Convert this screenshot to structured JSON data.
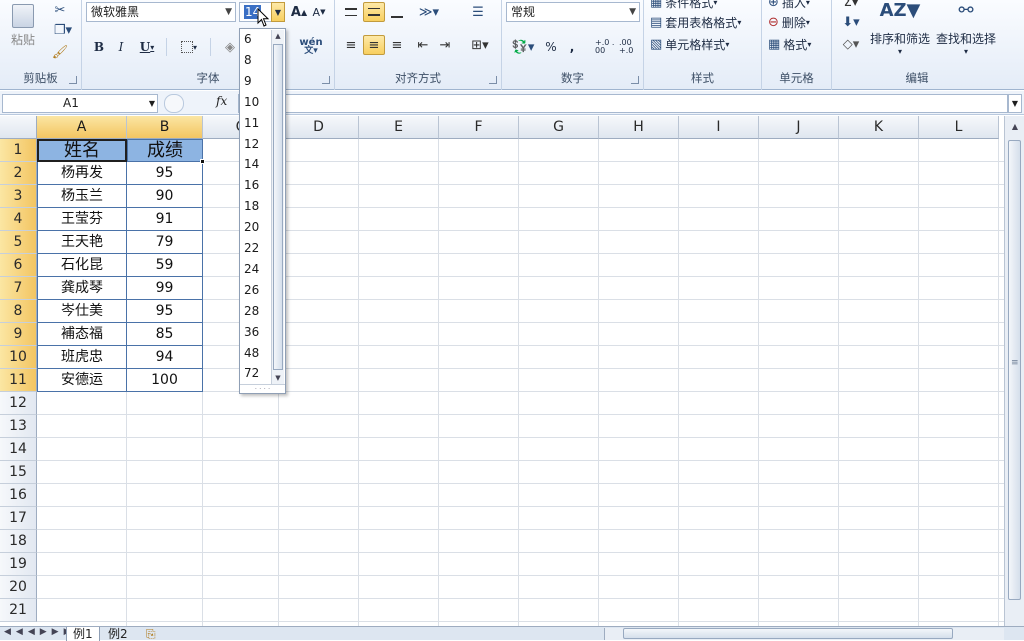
{
  "ribbon": {
    "clipboard": {
      "paste_label": "粘贴",
      "group_label": "剪贴板"
    },
    "font": {
      "font_name": "微软雅黑",
      "font_size": "14",
      "bold": "B",
      "italic": "I",
      "underline": "U",
      "grow": "A",
      "shrink": "A",
      "wen_label": "wén",
      "group_label": "字体"
    },
    "alignment": {
      "group_label": "对齐方式"
    },
    "number": {
      "format": "常规",
      "percent": "%",
      "comma": ",",
      "inc_decimal": "+.0 .00",
      "dec_decimal": ".00 +.0",
      "group_label": "数字"
    },
    "styles": {
      "conditional": "条件格式",
      "table_format": "套用表格格式",
      "cell_styles": "单元格样式",
      "group_label": "样式"
    },
    "cells": {
      "insert": "插入",
      "delete": "删除",
      "format": "格式",
      "group_label": "单元格"
    },
    "editing": {
      "sort_filter": "排序和筛选",
      "find_select": "查找和选择",
      "group_label": "编辑"
    }
  },
  "formula_bar": {
    "name_box": "A1",
    "fx": "fx",
    "value": ""
  },
  "font_size_dropdown": {
    "options": [
      "6",
      "8",
      "9",
      "10",
      "11",
      "12",
      "14",
      "16",
      "18",
      "20",
      "22",
      "24",
      "26",
      "28",
      "36",
      "48",
      "72"
    ]
  },
  "sheet": {
    "columns": [
      "A",
      "B",
      "C",
      "D",
      "E",
      "F",
      "G",
      "H",
      "I",
      "J",
      "K",
      "L"
    ],
    "rows": [
      "1",
      "2",
      "3",
      "4",
      "5",
      "6",
      "7",
      "8",
      "9",
      "10",
      "11",
      "12",
      "13",
      "14",
      "15",
      "16",
      "17",
      "18",
      "19",
      "20",
      "21"
    ],
    "header": {
      "name": "姓名",
      "score": "成绩"
    },
    "records": [
      {
        "name": "杨再发",
        "score": "95"
      },
      {
        "name": "杨玉兰",
        "score": "90"
      },
      {
        "name": "王莹芬",
        "score": "91"
      },
      {
        "name": "王天艳",
        "score": "79"
      },
      {
        "name": "石化昆",
        "score": "59"
      },
      {
        "name": "龚成琴",
        "score": "99"
      },
      {
        "name": "岑仕美",
        "score": "95"
      },
      {
        "name": "補态福",
        "score": "85"
      },
      {
        "name": "班虎忠",
        "score": "94"
      },
      {
        "name": "安德运",
        "score": "100"
      }
    ]
  },
  "tabs": [
    {
      "label": "例1"
    },
    {
      "label": "例2"
    }
  ],
  "colors": {
    "header_fill": "#8db4e2",
    "table_border": "#4a72a8",
    "selected_header": "#f3c562"
  }
}
